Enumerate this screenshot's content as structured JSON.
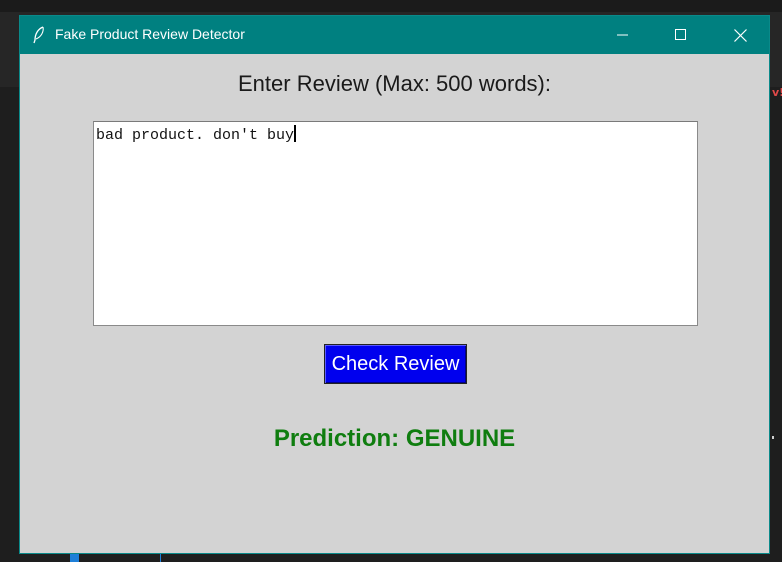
{
  "window": {
    "title": "Fake Product Review Detector",
    "icon": "feather-icon"
  },
  "prompt_label": "Enter Review (Max: 500 words):",
  "review_input": {
    "value": "bad product. don't buy"
  },
  "check_button_label": "Check Review",
  "prediction_text": "Prediction: GENUINE",
  "colors": {
    "titlebar": "#008080",
    "client_bg": "#d3d3d3",
    "button_bg": "#0000ee",
    "prediction": "#0f7d0f"
  }
}
